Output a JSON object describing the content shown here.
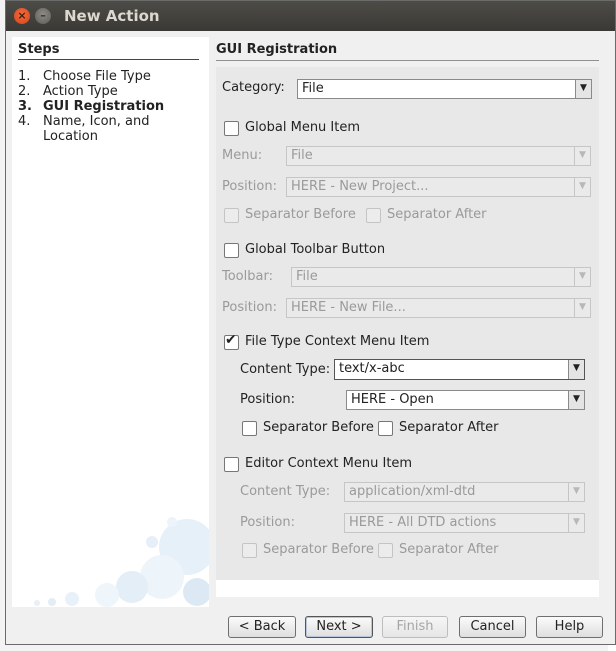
{
  "window": {
    "title": "New Action"
  },
  "steps": {
    "heading": "Steps",
    "items": [
      {
        "num": "1.",
        "label": "Choose File Type"
      },
      {
        "num": "2.",
        "label": "Action Type"
      },
      {
        "num": "3.",
        "label": "GUI Registration"
      },
      {
        "num": "4.",
        "label": "Name, Icon, and Location"
      }
    ],
    "current_step": 3
  },
  "panel": {
    "heading": "GUI Registration",
    "category_label": "Category:",
    "category_value": "File",
    "global_menu": {
      "label": "Global Menu Item",
      "checked": false,
      "menu_label": "Menu:",
      "menu_value": "File",
      "position_label": "Position:",
      "position_value": "HERE - New Project...",
      "separator_before": "Separator Before",
      "separator_after": "Separator After"
    },
    "global_toolbar": {
      "label": "Global Toolbar Button",
      "checked": false,
      "toolbar_label": "Toolbar:",
      "toolbar_value": "File",
      "position_label": "Position:",
      "position_value": "HERE - New File..."
    },
    "file_type_context": {
      "label": "File Type Context Menu Item",
      "checked": true,
      "content_type_label": "Content Type:",
      "content_type_value": "text/x-abc",
      "position_label": "Position:",
      "position_value": "HERE - Open",
      "separator_before": "Separator Before",
      "separator_after": "Separator After"
    },
    "editor_context": {
      "label": "Editor Context Menu Item",
      "checked": false,
      "content_type_label": "Content Type:",
      "content_type_value": "application/xml-dtd",
      "position_label": "Position:",
      "position_value": "HERE - All DTD actions",
      "separator_before": "Separator Before",
      "separator_after": "Separator After"
    }
  },
  "buttons": {
    "back": "< Back",
    "next": "Next >",
    "finish": "Finish",
    "cancel": "Cancel",
    "help": "Help"
  },
  "icons": {
    "close": "close-icon",
    "minimize": "minimize-icon",
    "dropdown": "chevron-down-icon",
    "checkmark": "checkmark-icon"
  }
}
